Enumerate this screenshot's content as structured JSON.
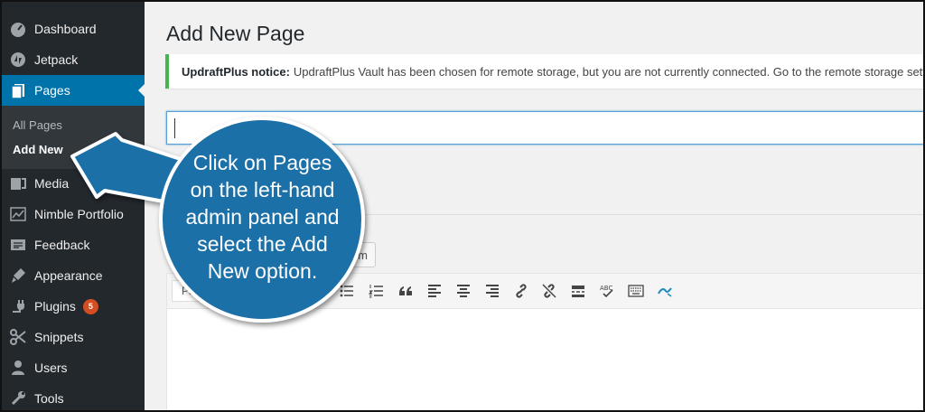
{
  "sidebar": {
    "items": [
      {
        "label": "Dashboard",
        "icon": "dashboard-icon"
      },
      {
        "label": "Jetpack",
        "icon": "jetpack-icon"
      },
      {
        "label": "Pages",
        "icon": "pages-icon"
      },
      {
        "label": "Media",
        "icon": "media-icon"
      },
      {
        "label": "Nimble Portfolio",
        "icon": "portfolio-icon"
      },
      {
        "label": "Feedback",
        "icon": "feedback-icon"
      },
      {
        "label": "Appearance",
        "icon": "appearance-icon"
      },
      {
        "label": "Plugins",
        "icon": "plugins-icon",
        "badge": "5"
      },
      {
        "label": "Snippets",
        "icon": "snippets-icon"
      },
      {
        "label": "Users",
        "icon": "users-icon"
      },
      {
        "label": "Tools",
        "icon": "tools-icon"
      }
    ],
    "submenu": {
      "all_pages": "All Pages",
      "add_new": "Add New"
    }
  },
  "main": {
    "title": "Add New Page",
    "notice": {
      "strong": "UpdraftPlus notice:",
      "text": "UpdraftPlus Vault has been chosen for remote storage, but you are not currently connected. Go to the remote storage setti"
    },
    "form_button": "orm",
    "editor": {
      "format_select": "Parag"
    }
  },
  "callout": {
    "lines": [
      "Click on Pages",
      "on the left-hand",
      "admin panel and",
      "select the Add",
      "New option."
    ]
  },
  "colors": {
    "sidebar_bg": "#23282d",
    "active": "#0073aa",
    "callout_blue": "#1e6fa8",
    "notice_border": "#46b450"
  }
}
